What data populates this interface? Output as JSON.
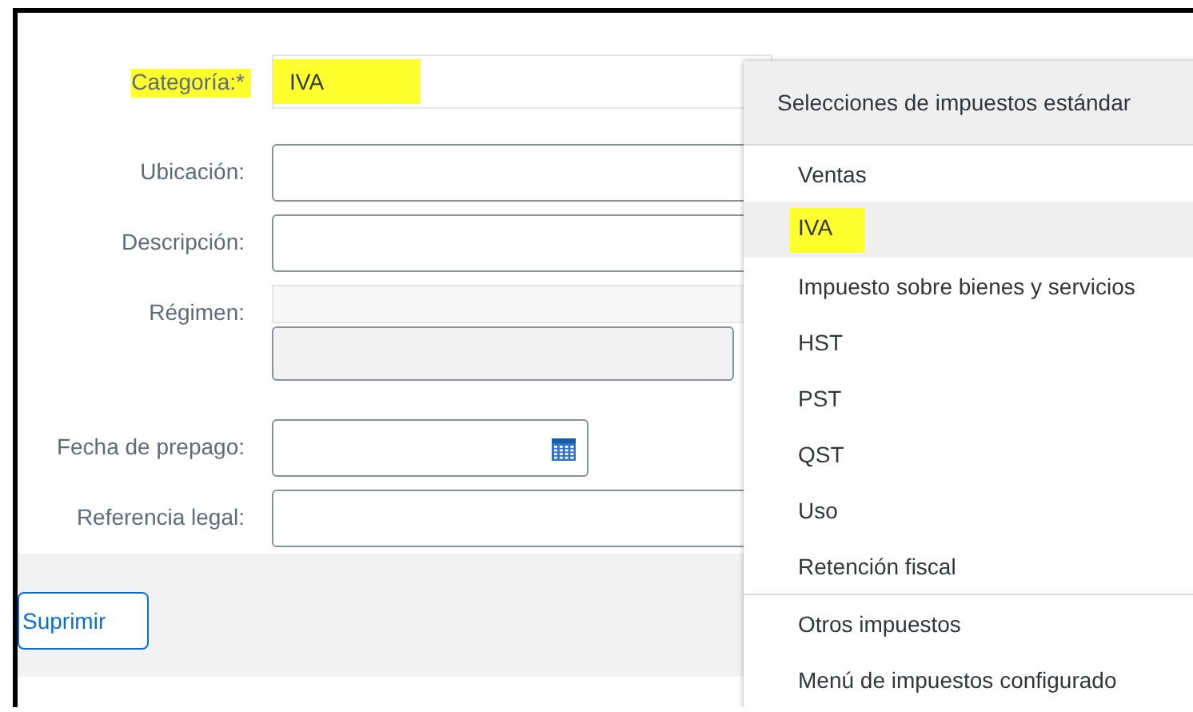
{
  "form": {
    "fields": [
      {
        "kind": "select",
        "label": "Categoría:",
        "required_mark": "*",
        "value": "IVA",
        "highlighted": true
      },
      {
        "kind": "text",
        "label": "Ubicación:",
        "highlighted": false
      },
      {
        "kind": "text",
        "label": "Descripción:",
        "highlighted": false
      },
      {
        "kind": "disabled_select",
        "label": "Régimen:",
        "highlighted": false
      },
      {
        "kind": "date",
        "label": "Fecha de prepago:",
        "highlighted": false
      },
      {
        "kind": "text",
        "label": "Referencia legal:",
        "highlighted": false
      }
    ]
  },
  "footer": {
    "buttons": [
      "Suprimir"
    ]
  },
  "dropdown": {
    "header": "Selecciones de impuestos estándar",
    "groups": [
      [
        {
          "label": "Ventas",
          "selected": false,
          "highlighted": false
        },
        {
          "label": "IVA",
          "selected": true,
          "highlighted": true
        },
        {
          "label": "Impuesto sobre bienes y servicios",
          "selected": false,
          "highlighted": false
        },
        {
          "label": "HST",
          "selected": false,
          "highlighted": false
        },
        {
          "label": "PST",
          "selected": false,
          "highlighted": false
        },
        {
          "label": "QST",
          "selected": false,
          "highlighted": false
        },
        {
          "label": "Uso",
          "selected": false,
          "highlighted": false
        },
        {
          "label": "Retención fiscal",
          "selected": false,
          "highlighted": false
        }
      ],
      [
        {
          "label": "Otros impuestos",
          "selected": false,
          "highlighted": false
        },
        {
          "label": "Menú de impuestos configurado",
          "selected": false,
          "highlighted": false
        }
      ]
    ]
  }
}
